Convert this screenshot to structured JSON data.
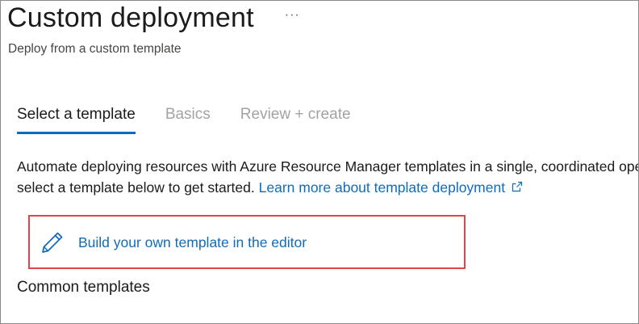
{
  "header": {
    "title": "Custom deployment",
    "subtitle": "Deploy from a custom template",
    "more_label": "···"
  },
  "tabs": [
    {
      "label": "Select a template",
      "active": true
    },
    {
      "label": "Basics",
      "active": false
    },
    {
      "label": "Review + create",
      "active": false
    }
  ],
  "description": {
    "line1": "Automate deploying resources with Azure Resource Manager templates in a single, coordinated operation. Create or",
    "line2": "select a template below to get started.",
    "link_text": "Learn more about template deployment",
    "link_icon": "external-link-icon"
  },
  "build_template": {
    "label": "Build your own template in the editor",
    "icon": "pencil-icon"
  },
  "section": {
    "common_templates_heading": "Common templates"
  },
  "colors": {
    "accent": "#0f6cbd",
    "highlight_border": "#e0454b",
    "inactive_tab": "#a3a3a3"
  }
}
